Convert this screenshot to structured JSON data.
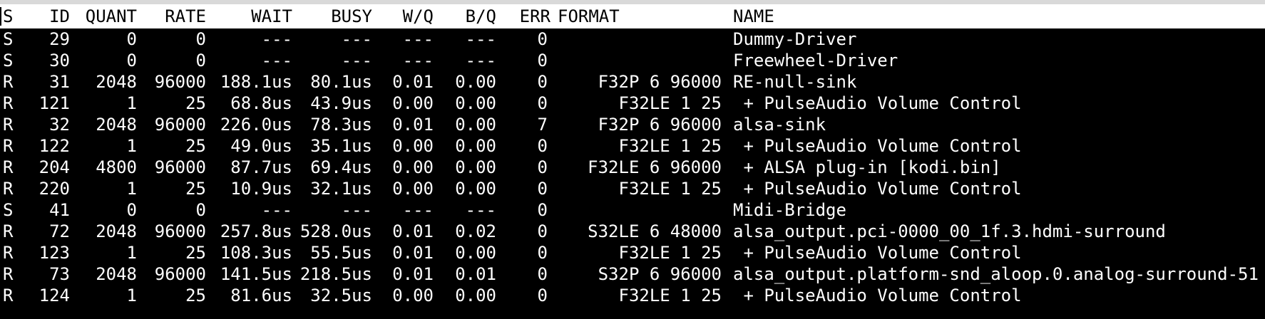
{
  "columns": {
    "s": "S",
    "id": "ID",
    "quant": "QUANT",
    "rate": "RATE",
    "wait": "WAIT",
    "busy": "BUSY",
    "wq": "W/Q",
    "bq": "B/Q",
    "err": "ERR",
    "format": "FORMAT",
    "name": "NAME"
  },
  "rows": [
    {
      "s": "S",
      "id": "29",
      "quant": "0",
      "rate": "0",
      "wait": "---",
      "busy": "---",
      "wq": "---",
      "bq": "---",
      "err": "0",
      "format": "",
      "name": "Dummy-Driver"
    },
    {
      "s": "S",
      "id": "30",
      "quant": "0",
      "rate": "0",
      "wait": "---",
      "busy": "---",
      "wq": "---",
      "bq": "---",
      "err": "0",
      "format": "",
      "name": "Freewheel-Driver"
    },
    {
      "s": "R",
      "id": "31",
      "quant": "2048",
      "rate": "96000",
      "wait": "188.1us",
      "busy": "80.1us",
      "wq": "0.01",
      "bq": "0.00",
      "err": "0",
      "format": "F32P 6 96000",
      "name": "RE-null-sink"
    },
    {
      "s": "R",
      "id": "121",
      "quant": "1",
      "rate": "25",
      "wait": "68.8us",
      "busy": "43.9us",
      "wq": "0.00",
      "bq": "0.00",
      "err": "0",
      "format": "F32LE 1 25",
      "name": " + PulseAudio Volume Control"
    },
    {
      "s": "R",
      "id": "32",
      "quant": "2048",
      "rate": "96000",
      "wait": "226.0us",
      "busy": "78.3us",
      "wq": "0.01",
      "bq": "0.00",
      "err": "7",
      "format": "F32P 6 96000",
      "name": "alsa-sink"
    },
    {
      "s": "R",
      "id": "122",
      "quant": "1",
      "rate": "25",
      "wait": "49.0us",
      "busy": "35.1us",
      "wq": "0.00",
      "bq": "0.00",
      "err": "0",
      "format": "F32LE 1 25",
      "name": " + PulseAudio Volume Control"
    },
    {
      "s": "R",
      "id": "204",
      "quant": "4800",
      "rate": "96000",
      "wait": "87.7us",
      "busy": "69.4us",
      "wq": "0.00",
      "bq": "0.00",
      "err": "0",
      "format": "F32LE 6 96000",
      "name": " + ALSA plug-in [kodi.bin]"
    },
    {
      "s": "R",
      "id": "220",
      "quant": "1",
      "rate": "25",
      "wait": "10.9us",
      "busy": "32.1us",
      "wq": "0.00",
      "bq": "0.00",
      "err": "0",
      "format": "F32LE 1 25",
      "name": " + PulseAudio Volume Control"
    },
    {
      "s": "S",
      "id": "41",
      "quant": "0",
      "rate": "0",
      "wait": "---",
      "busy": "---",
      "wq": "---",
      "bq": "---",
      "err": "0",
      "format": "",
      "name": "Midi-Bridge"
    },
    {
      "s": "R",
      "id": "72",
      "quant": "2048",
      "rate": "96000",
      "wait": "257.8us",
      "busy": "528.0us",
      "wq": "0.01",
      "bq": "0.02",
      "err": "0",
      "format": "S32LE 6 48000",
      "name": "alsa_output.pci-0000_00_1f.3.hdmi-surround"
    },
    {
      "s": "R",
      "id": "123",
      "quant": "1",
      "rate": "25",
      "wait": "108.3us",
      "busy": "55.5us",
      "wq": "0.01",
      "bq": "0.00",
      "err": "0",
      "format": "F32LE 1 25",
      "name": " + PulseAudio Volume Control"
    },
    {
      "s": "R",
      "id": "73",
      "quant": "2048",
      "rate": "96000",
      "wait": "141.5us",
      "busy": "218.5us",
      "wq": "0.01",
      "bq": "0.01",
      "err": "0",
      "format": "S32P 6 96000",
      "name": "alsa_output.platform-snd_aloop.0.analog-surround-51"
    },
    {
      "s": "R",
      "id": "124",
      "quant": "1",
      "rate": "25",
      "wait": "81.6us",
      "busy": "32.5us",
      "wq": "0.00",
      "bq": "0.00",
      "err": "0",
      "format": "F32LE 1 25",
      "name": " + PulseAudio Volume Control"
    }
  ]
}
